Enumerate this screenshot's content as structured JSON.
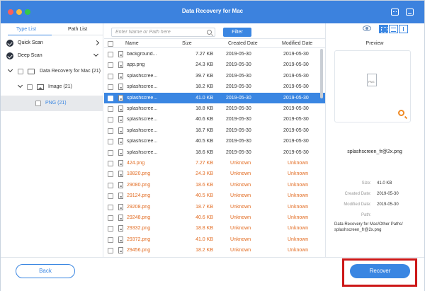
{
  "window": {
    "title": "Data Recovery for Mac"
  },
  "left": {
    "tabs": [
      "Type List",
      "Path List"
    ],
    "scans": [
      "Quick Scan",
      "Deep Scan"
    ],
    "tree": [
      {
        "label": "Data Recovery for Mac (21)"
      },
      {
        "label": "Image (21)"
      },
      {
        "label": "PNG (21)"
      }
    ]
  },
  "search": {
    "placeholder": "Enter Name or Path here",
    "filter_label": "Filter"
  },
  "table": {
    "headers": {
      "name": "Name",
      "size": "Size",
      "created": "Created Date",
      "modified": "Modified Date"
    },
    "rows": [
      {
        "name": "background...",
        "size": "7.27 KB",
        "created": "2019-05-30",
        "modified": "2019-05-30"
      },
      {
        "name": "app.png",
        "size": "24.3 KB",
        "created": "2019-05-30",
        "modified": "2019-05-30"
      },
      {
        "name": "splashscree...",
        "size": "39.7 KB",
        "created": "2019-05-30",
        "modified": "2019-05-30"
      },
      {
        "name": "splashscree...",
        "size": "18.2 KB",
        "created": "2019-05-30",
        "modified": "2019-05-30"
      },
      {
        "name": "splashscree...",
        "size": "41.0 KB",
        "created": "2019-05-30",
        "modified": "2019-05-30"
      },
      {
        "name": "splashscree...",
        "size": "18.8 KB",
        "created": "2019-05-30",
        "modified": "2019-05-30"
      },
      {
        "name": "splashscree...",
        "size": "40.6 KB",
        "created": "2019-05-30",
        "modified": "2019-05-30"
      },
      {
        "name": "splashscree...",
        "size": "18.7 KB",
        "created": "2019-05-30",
        "modified": "2019-05-30"
      },
      {
        "name": "splashscree...",
        "size": "40.5 KB",
        "created": "2019-05-30",
        "modified": "2019-05-30"
      },
      {
        "name": "splashscree...",
        "size": "18.6 KB",
        "created": "2019-05-30",
        "modified": "2019-05-30"
      },
      {
        "name": "424.png",
        "size": "7.27 KB",
        "created": "Unknown",
        "modified": "Unknown"
      },
      {
        "name": "18820.png",
        "size": "24.3 KB",
        "created": "Unknown",
        "modified": "Unknown"
      },
      {
        "name": "29080.png",
        "size": "18.6 KB",
        "created": "Unknown",
        "modified": "Unknown"
      },
      {
        "name": "29124.png",
        "size": "40.5 KB",
        "created": "Unknown",
        "modified": "Unknown"
      },
      {
        "name": "29208.png",
        "size": "18.7 KB",
        "created": "Unknown",
        "modified": "Unknown"
      },
      {
        "name": "29248.png",
        "size": "40.6 KB",
        "created": "Unknown",
        "modified": "Unknown"
      },
      {
        "name": "29332.png",
        "size": "18.8 KB",
        "created": "Unknown",
        "modified": "Unknown"
      },
      {
        "name": "29372.png",
        "size": "41.0 KB",
        "created": "Unknown",
        "modified": "Unknown"
      },
      {
        "name": "29456.png",
        "size": "18.2 KB",
        "created": "Unknown",
        "modified": "Unknown"
      }
    ]
  },
  "preview": {
    "label": "Preview",
    "filename": "splashscreen_fr@2x.png",
    "info": {
      "size_label": "Size:",
      "size": "41.0 KB",
      "created_label": "Created Date:",
      "created": "2019-05-30",
      "modified_label": "Modified Date:",
      "modified": "2019-05-30",
      "path_label": "Path:",
      "path_line1": "Data Recovery for Mac/Other Paths/",
      "path_line2": "splashscreen_fr@2x.png"
    }
  },
  "footer": {
    "back_label": "Back",
    "recover_label": "Recover"
  },
  "colors": {
    "accent": "#3a86e2",
    "unknown_text": "#e26b21",
    "highlight": "#cc1717"
  },
  "icons": [
    "feedback-icon",
    "minimize-icon",
    "search-icon",
    "eye-icon",
    "grid-view-icon",
    "list-view-icon",
    "panel-view-icon",
    "zoom-icon",
    "file-icon",
    "disk-icon",
    "image-icon"
  ]
}
